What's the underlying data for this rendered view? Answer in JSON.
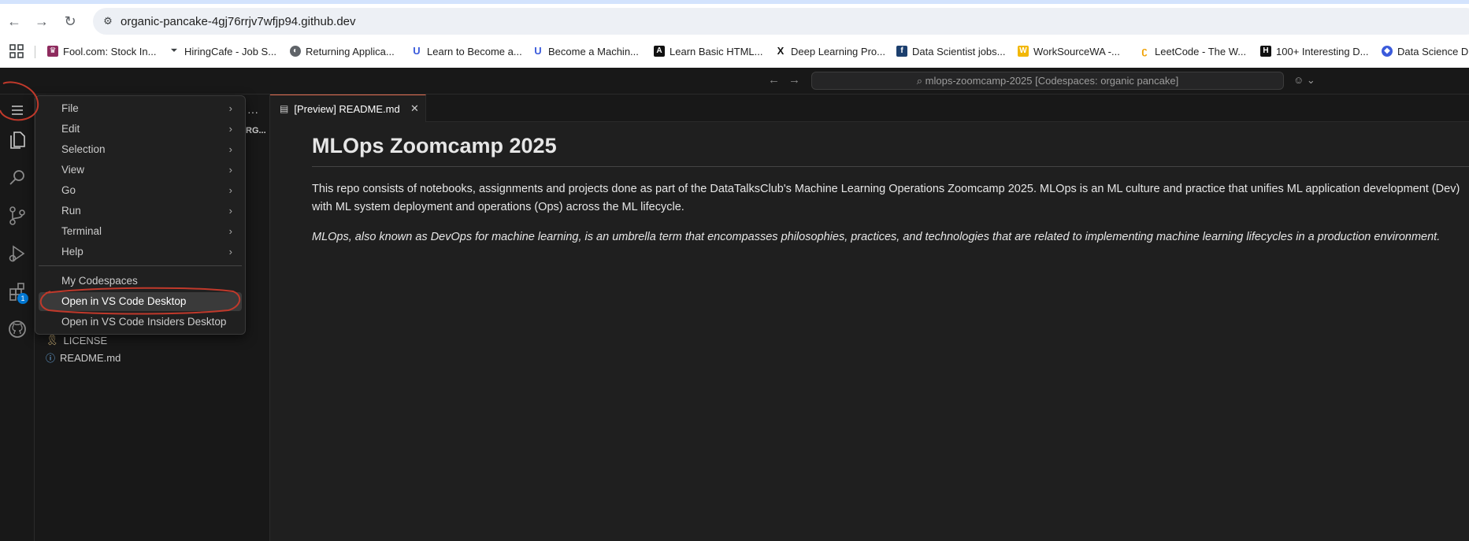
{
  "browser": {
    "url": "organic-pancake-4gj76rrjv7wfjp94.github.dev",
    "bookmarks": [
      {
        "label": "Fool.com: Stock In...",
        "icon": "fool-icon"
      },
      {
        "label": "HiringCafe - Job S...",
        "icon": "filter-icon"
      },
      {
        "label": "Returning Applica...",
        "icon": "globe-icon"
      },
      {
        "label": "Learn to Become a...",
        "icon": "udacity-icon"
      },
      {
        "label": "Become a Machin...",
        "icon": "udacity-icon"
      },
      {
        "label": "Learn Basic HTML...",
        "icon": "html-icon"
      },
      {
        "label": "Deep Learning Pro...",
        "icon": "x-icon"
      },
      {
        "label": "Data Scientist jobs...",
        "icon": "f-icon"
      },
      {
        "label": "WorkSourceWA -...",
        "icon": "w-icon"
      },
      {
        "label": "LeetCode - The W...",
        "icon": "leetcode-icon"
      },
      {
        "label": "100+ Interesting D...",
        "icon": "h-icon"
      },
      {
        "label": "Data Science Dr...",
        "icon": "bookmark-icon"
      }
    ]
  },
  "vscode": {
    "command_center": "mlops-zoomcamp-2025 [Codespaces: organic pancake]",
    "sidebar": {
      "truncated_header": "RG...",
      "files": [
        {
          "name": "LICENSE",
          "icon": "license-icon"
        },
        {
          "name": "README.md",
          "icon": "info-icon"
        }
      ]
    },
    "tab": {
      "label": "[Preview] README.md"
    },
    "activity_badge": "1",
    "menu": {
      "items": [
        {
          "label": "File",
          "submenu": true
        },
        {
          "label": "Edit",
          "submenu": true
        },
        {
          "label": "Selection",
          "submenu": true
        },
        {
          "label": "View",
          "submenu": true
        },
        {
          "label": "Go",
          "submenu": true
        },
        {
          "label": "Run",
          "submenu": true
        },
        {
          "label": "Terminal",
          "submenu": true
        },
        {
          "label": "Help",
          "submenu": true
        }
      ],
      "extra_items": [
        {
          "label": "My Codespaces"
        },
        {
          "label": "Open in VS Code Desktop",
          "highlighted": true
        },
        {
          "label": "Open in VS Code Insiders Desktop"
        }
      ]
    },
    "preview": {
      "title": "MLOps Zoomcamp 2025",
      "paragraph": "This repo consists of notebooks, assignments and projects done as part of the DataTalksClub's Machine Learning Operations Zoomcamp 2025. MLOps is an ML culture and practice that unifies ML application development (Dev) with ML system deployment and operations (Ops) across the ML lifecycle.",
      "italic_paragraph": "MLOps, also known as DevOps for machine learning, is an umbrella term that encompasses philosophies, practices, and technologies that are related to implementing machine learning lifecycles in a production environment."
    }
  },
  "colors": {
    "annotation": "#c0392b",
    "tab_accent": "#e06c4f",
    "badge": "#0078d4"
  }
}
